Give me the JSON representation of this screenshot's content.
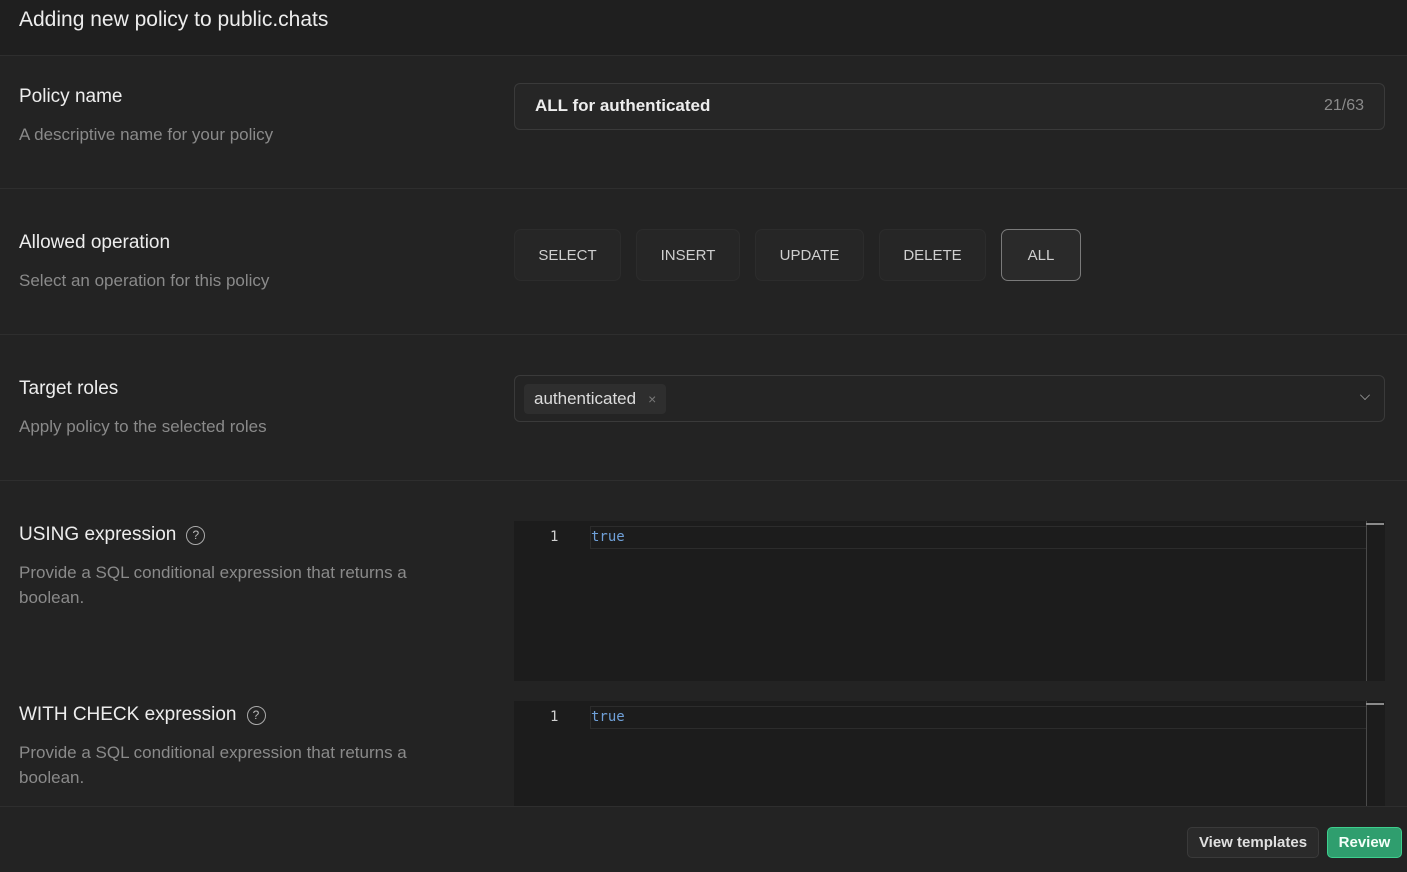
{
  "header": {
    "title": "Adding new policy to public.chats"
  },
  "policy_name": {
    "label": "Policy name",
    "description": "A descriptive name for your policy",
    "value": "ALL for authenticated",
    "counter": "21/63"
  },
  "operation": {
    "label": "Allowed operation",
    "description": "Select an operation for this policy",
    "options": [
      "SELECT",
      "INSERT",
      "UPDATE",
      "DELETE",
      "ALL"
    ],
    "selected": "ALL"
  },
  "roles": {
    "label": "Target roles",
    "description": "Apply policy to the selected roles",
    "selected": [
      "authenticated"
    ],
    "remove_glyph": "×"
  },
  "using": {
    "label": "USING expression",
    "description": "Provide a SQL conditional expression that returns a boolean.",
    "line_number": "1",
    "code": "true",
    "help_glyph": "?"
  },
  "with_check": {
    "label": "WITH CHECK expression",
    "description": "Provide a SQL conditional expression that returns a boolean.",
    "line_number": "1",
    "code": "true",
    "help_glyph": "?"
  },
  "footer": {
    "view_templates": "View templates",
    "review": "Review"
  },
  "colors": {
    "accent": "#3ecf8e",
    "background": "#232323"
  }
}
